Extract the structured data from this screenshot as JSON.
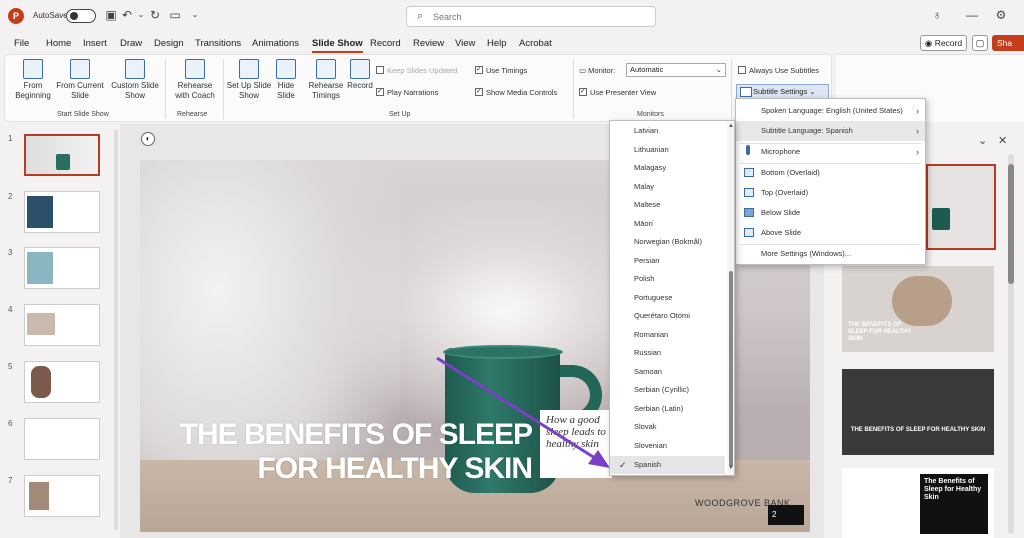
{
  "titlebar": {
    "app_icon": "P",
    "autosave_label": "AutoSave",
    "search_placeholder": "Search",
    "icons": [
      "save-icon",
      "undo-icon",
      "redo-icon",
      "present-icon",
      "customize-icon",
      "lightbulb-icon",
      "minimize-icon",
      "settings-icon"
    ]
  },
  "tabs": [
    "File",
    "Home",
    "Insert",
    "Draw",
    "Design",
    "Transitions",
    "Animations",
    "Slide Show",
    "Record",
    "Review",
    "View",
    "Help",
    "Acrobat"
  ],
  "active_tab": "Slide Show",
  "top_right": {
    "record_label": "Record",
    "share_label": "Sha"
  },
  "ribbon": {
    "from_beginning": "From Beginning",
    "from_current": "From Current Slide",
    "custom_show": "Custom Slide Show",
    "rehearse_coach": "Rehearse with Coach",
    "set_up": "Set Up Slide Show",
    "hide_slide": "Hide Slide",
    "rehearse_timings": "Rehearse Timings",
    "record": "Record",
    "keep_updated": "Keep Slides Updated",
    "play_narrations": "Play Narrations",
    "use_timings": "Use Timings",
    "show_media": "Show Media Controls",
    "monitor_label": "Monitor:",
    "monitor_value": "Automatic",
    "presenter_view": "Use Presenter View",
    "always_subtitles": "Always Use Subtitles",
    "subtitle_settings": "Subtitle Settings",
    "groups": {
      "start": "Start Slide Show",
      "rehearse": "Rehearse",
      "setup": "Set Up",
      "monitors": "Monitors"
    }
  },
  "thumbnails": [
    "1",
    "2",
    "3",
    "4",
    "5",
    "6",
    "7"
  ],
  "slide": {
    "title": "THE BENEFITS OF SLEEP FOR HEALTHY SKIN",
    "card_text": "How a good sleep leads to healthy skin",
    "brand": "WOODGROVE BANK",
    "brand_box": "2"
  },
  "language_list": [
    "Latvian",
    "Lithuanian",
    "Malagasy",
    "Malay",
    "Maltese",
    "Māori",
    "Norwegian (Bokmål)",
    "Persian",
    "Polish",
    "Portuguese",
    "Querétaro Otomi",
    "Romanian",
    "Russian",
    "Samoan",
    "Serbian (Cyrillic)",
    "Serbian (Latin)",
    "Slovak",
    "Slovenian",
    "Spanish"
  ],
  "language_selected": "Spanish",
  "subtitle_menu": {
    "spoken": "Spoken Language: English (United States)",
    "subtitle_lang": "Subtitle Language: Spanish",
    "microphone": "Microphone",
    "bottom": "Bottom (Overlaid)",
    "top": "Top (Overlaid)",
    "below": "Below Slide",
    "above": "Above Slide",
    "more": "More Settings (Windows)..."
  },
  "preview_slides": {
    "slide3_text": "THE BENEFITS OF SLEEP FOR HEALTHY SKIN",
    "slide4_text": "The Benefits of Sleep for Healthy Skin"
  },
  "colors": {
    "accent": "#c43e1c",
    "arrow": "#7b3fc8",
    "mug": "#2a6e61"
  }
}
